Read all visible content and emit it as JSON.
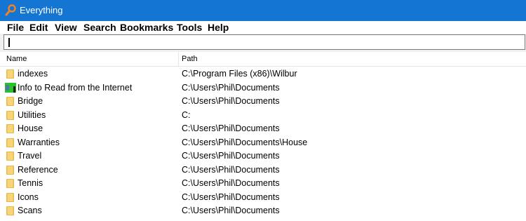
{
  "window": {
    "title": "Everything"
  },
  "menu": {
    "items": [
      "File",
      "Edit",
      "View",
      "Search",
      "Bookmarks",
      "Tools",
      "Help"
    ]
  },
  "search": {
    "value": "",
    "placeholder": ""
  },
  "list": {
    "columns": [
      "Name",
      "Path"
    ],
    "rows": [
      {
        "name": "indexes",
        "path": "C:\\Program Files (x86)\\Wilbur",
        "icon": "folder-icon"
      },
      {
        "name": "Info to Read from the Internet",
        "path": "C:\\Users\\Phil\\Documents",
        "icon": "special-folder-icon"
      },
      {
        "name": "Bridge",
        "path": "C:\\Users\\Phil\\Documents",
        "icon": "folder-icon"
      },
      {
        "name": "Utilities",
        "path": "C:",
        "icon": "folder-icon"
      },
      {
        "name": "House",
        "path": "C:\\Users\\Phil\\Documents",
        "icon": "folder-icon"
      },
      {
        "name": "Warranties",
        "path": "C:\\Users\\Phil\\Documents\\House",
        "icon": "folder-icon"
      },
      {
        "name": "Travel",
        "path": "C:\\Users\\Phil\\Documents",
        "icon": "folder-icon"
      },
      {
        "name": "Reference",
        "path": "C:\\Users\\Phil\\Documents",
        "icon": "folder-icon"
      },
      {
        "name": "Tennis",
        "path": "C:\\Users\\Phil\\Documents",
        "icon": "folder-icon"
      },
      {
        "name": "Icons",
        "path": "C:\\Users\\Phil\\Documents",
        "icon": "folder-icon"
      },
      {
        "name": "Scans",
        "path": "C:\\Users\\Phil\\Documents",
        "icon": "folder-icon"
      }
    ]
  },
  "colors": {
    "titlebar": "#1476d2",
    "folder": "#e8b84a",
    "folder_light": "#f7d67a",
    "special_icon_green": "#27c427"
  }
}
